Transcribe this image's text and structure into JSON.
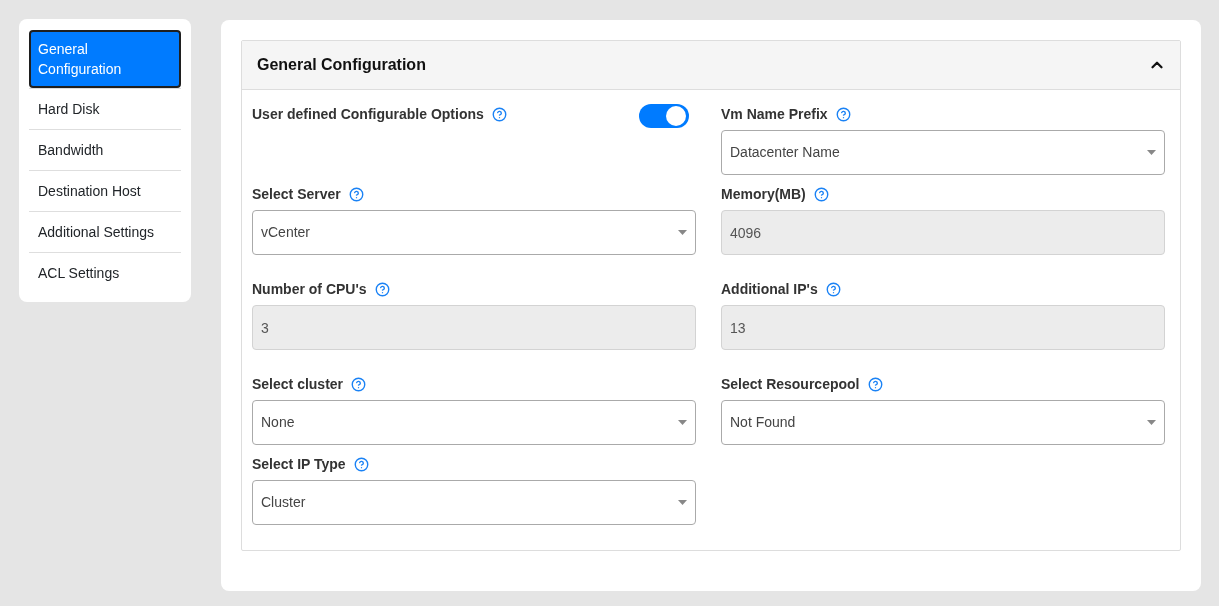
{
  "sidebar": {
    "items": [
      {
        "label": "General Configuration",
        "selected": true
      },
      {
        "label": "Hard Disk",
        "selected": false
      },
      {
        "label": "Bandwidth",
        "selected": false
      },
      {
        "label": "Destination Host",
        "selected": false
      },
      {
        "label": "Additional Settings",
        "selected": false
      },
      {
        "label": "ACL Settings",
        "selected": false
      }
    ]
  },
  "panel": {
    "title": "General Configuration",
    "expanded": true,
    "rows": [
      [
        {
          "kind": "toggle",
          "label": "User defined Configurable Options",
          "on": true
        },
        {
          "kind": "select",
          "label": "Vm Name Prefix",
          "value": "Datacenter Name"
        }
      ],
      [
        {
          "kind": "select",
          "label": "Select Server",
          "value": "vCenter"
        },
        {
          "kind": "input",
          "label": "Memory(MB)",
          "value": "4096",
          "disabled": true
        }
      ],
      [
        {
          "kind": "input",
          "label": "Number of CPU's",
          "value": "3",
          "disabled": true
        },
        {
          "kind": "input",
          "label": "Additional IP's",
          "value": "13",
          "disabled": true
        }
      ],
      [
        {
          "kind": "select",
          "label": "Select cluster",
          "value": "None"
        },
        {
          "kind": "select",
          "label": "Select Resourcepool",
          "value": "Not Found"
        }
      ],
      [
        {
          "kind": "select",
          "label": "Select IP Type",
          "value": "Cluster"
        }
      ]
    ]
  }
}
